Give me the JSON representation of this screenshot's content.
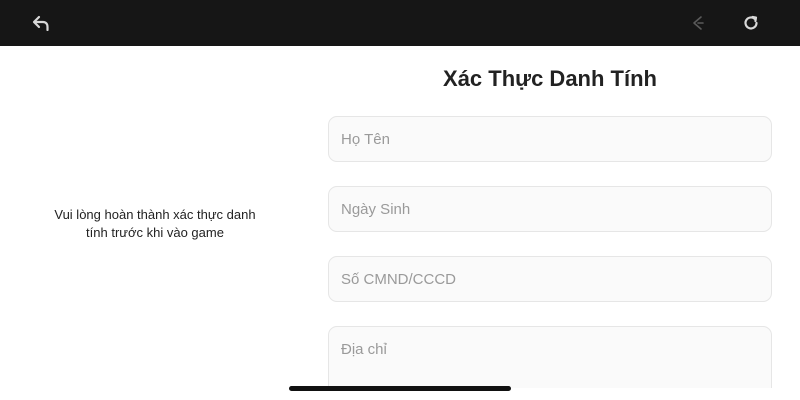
{
  "toolbar": {
    "back_icon": "undo-arrow-icon",
    "forward_icon": "forward-sparkle-icon",
    "refresh_icon": "refresh-icon",
    "bar_color": "#161616"
  },
  "side_message": {
    "line1": "Vui lòng hoàn thành xác thực danh",
    "line2": "tính trước khi vào game"
  },
  "form": {
    "title": "Xác Thực Danh Tính",
    "name_placeholder": "Họ Tên",
    "dob_placeholder": "Ngày Sinh",
    "id_placeholder": "Số CMND/CCCD",
    "address_placeholder": "Địa chỉ"
  }
}
